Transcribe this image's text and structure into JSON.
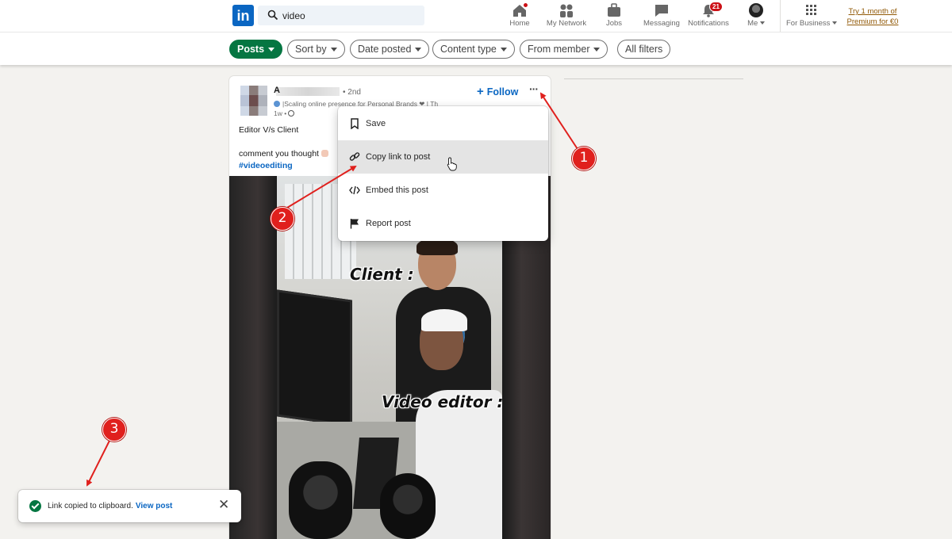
{
  "topnav": {
    "logo_text": "in",
    "search_value": "video",
    "items": [
      {
        "label": "Home",
        "icon": "home-icon"
      },
      {
        "label": "My Network",
        "icon": "network-icon"
      },
      {
        "label": "Jobs",
        "icon": "briefcase-icon"
      },
      {
        "label": "Messaging",
        "icon": "messaging-icon"
      },
      {
        "label": "Notifications",
        "icon": "bell-icon",
        "badge": "21"
      },
      {
        "label": "Me",
        "icon": "avatar"
      },
      {
        "label": "For Business",
        "icon": "grid-icon"
      }
    ],
    "premium_line1": "Try 1 month of",
    "premium_line2": "Premium for €0"
  },
  "filters": {
    "items": [
      "Posts",
      "Sort by",
      "Date posted",
      "Content type",
      "From member",
      "All filters"
    ]
  },
  "post": {
    "author_name": "A",
    "degree": "• 2nd",
    "headline": "|Scaling online presence for Personal Brands ❤ | Th",
    "time": "1w •",
    "follow_label": "Follow",
    "more_label": "···",
    "text_line1": "Editor V/s Client",
    "text_line2": "comment you thought",
    "hashtag": "#videoediting",
    "video_caption_1": "Client :",
    "video_caption_2": "Video editor :"
  },
  "menu": {
    "items": [
      {
        "label": "Save",
        "icon": "bookmark-icon"
      },
      {
        "label": "Copy link to post",
        "icon": "link-icon"
      },
      {
        "label": "Embed this post",
        "icon": "code-icon"
      },
      {
        "label": "Report post",
        "icon": "flag-icon"
      }
    ]
  },
  "toast": {
    "message": "Link copied to clipboard.",
    "link": "View post",
    "close": "✕"
  },
  "annotations": {
    "step1": "1",
    "step2": "2",
    "step3": "3",
    "color": "#e0201d"
  },
  "colors": {
    "brand": "#0a66c2",
    "posts_active": "#057642",
    "premium": "#915907",
    "badge": "#cc1016"
  }
}
